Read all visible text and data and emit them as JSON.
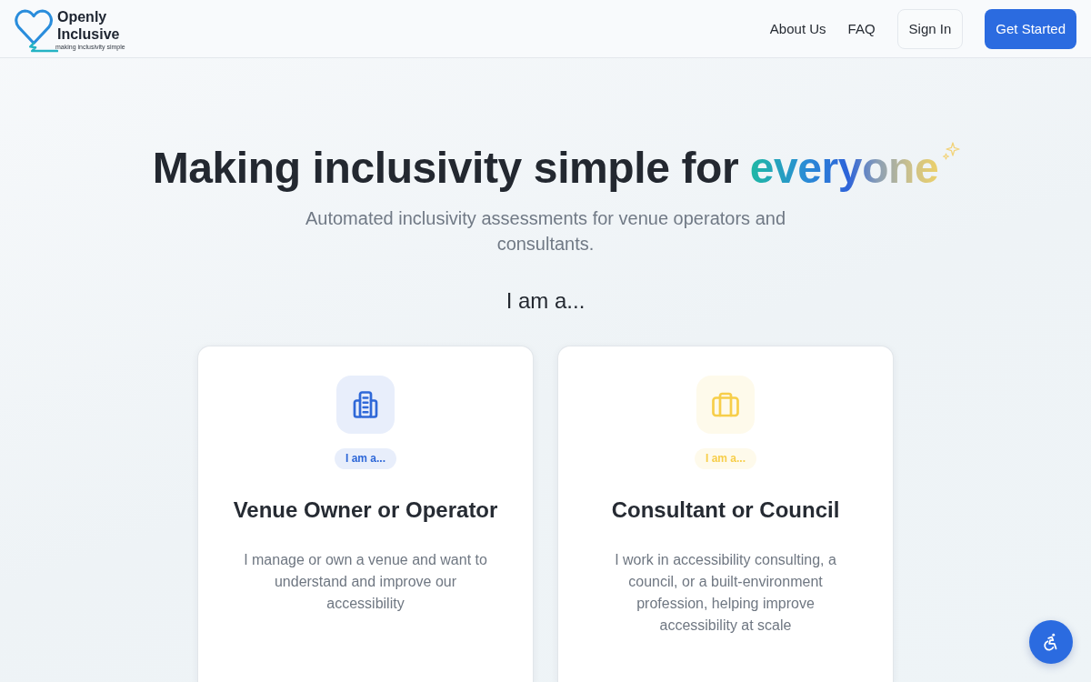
{
  "header": {
    "logo": {
      "name": "Openly Inclusive",
      "tagline": "making inclusivity simple"
    },
    "nav": [
      {
        "label": "About Us",
        "kind": "link"
      },
      {
        "label": "FAQ",
        "kind": "link"
      },
      {
        "label": "Sign In",
        "kind": "outline"
      },
      {
        "label": "Get Started",
        "kind": "primary"
      }
    ]
  },
  "hero": {
    "title": "Making inclusivity simple for",
    "title_highlight": "everyone",
    "subtitle": "Automated inclusivity assessments for venue operators and consultants.",
    "prompt": "I am a..."
  },
  "roles": [
    {
      "kind": "building",
      "color": "#2f68d8",
      "badge": "I am a...",
      "title": "Venue Owner or Operator",
      "description": "I manage or own a venue and want to understand and improve our accessibility"
    },
    {
      "kind": "briefcase",
      "color": "#f7ce4a",
      "badge": "I am a...",
      "title": "Consultant or Council",
      "description": "I work in accessibility consulting, a council, or a built-environment profession, helping improve accessibility at scale"
    }
  ]
}
